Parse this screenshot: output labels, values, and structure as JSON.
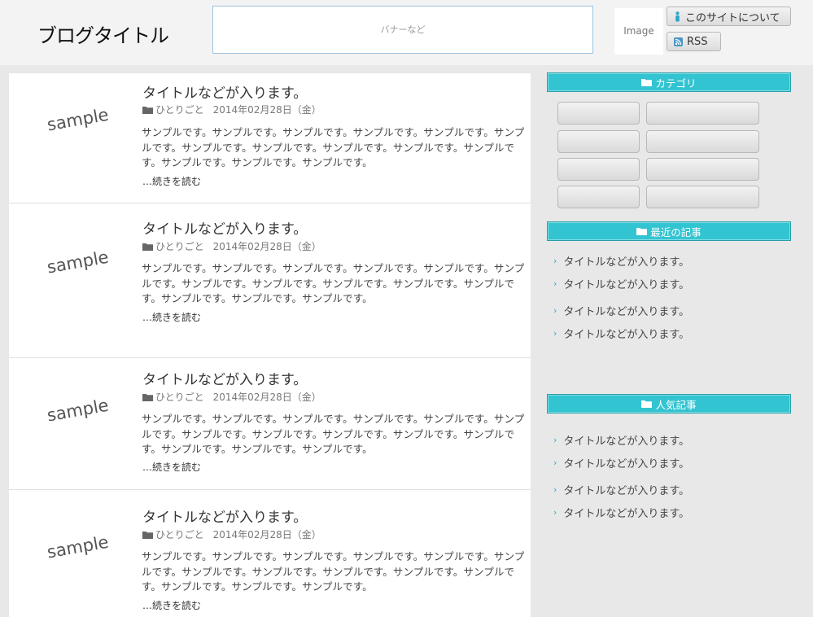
{
  "header": {
    "site_title": "ブログタイトル",
    "banner_text": "バナーなど",
    "image_text": "Image",
    "about_label": "このサイトについて",
    "rss_label": "RSS"
  },
  "posts": [
    {
      "thumb": "sample",
      "title": "タイトルなどが入ります。",
      "category": "ひとりごと",
      "date": "2014年02月28日（金）",
      "excerpt": "サンプルです。サンプルです。サンプルです。サンプルです。サンプルです。サンプルです。サンプルです。サンプルです。サンプルです。サンプルです。サンプルです。サンプルです。サンプルです。サンプルです。",
      "more": "…続きを読む"
    },
    {
      "thumb": "sample",
      "title": "タイトルなどが入ります。",
      "category": "ひとりごと",
      "date": "2014年02月28日（金）",
      "excerpt": "サンプルです。サンプルです。サンプルです。サンプルです。サンプルです。サンプルです。サンプルです。サンプルです。サンプルです。サンプルです。サンプルです。サンプルです。サンプルです。サンプルです。",
      "more": "…続きを読む"
    },
    {
      "thumb": "sample",
      "title": "タイトルなどが入ります。",
      "category": "ひとりごと",
      "date": "2014年02月28日（金）",
      "excerpt": "サンプルです。サンプルです。サンプルです。サンプルです。サンプルです。サンプルです。サンプルです。サンプルです。サンプルです。サンプルです。サンプルです。サンプルです。サンプルです。サンプルです。",
      "more": "…続きを読む"
    },
    {
      "thumb": "sample",
      "title": "タイトルなどが入ります。",
      "category": "ひとりごと",
      "date": "2014年02月28日（金）",
      "excerpt": "サンプルです。サンプルです。サンプルです。サンプルです。サンプルです。サンプルです。サンプルです。サンプルです。サンプルです。サンプルです。サンプルです。サンプルです。サンプルです。サンプルです。",
      "more": "…続きを読む"
    }
  ],
  "sidebar": {
    "category_heading": "カテゴリ",
    "recent_heading": "最近の記事",
    "recent_items": [
      "タイトルなどが入ります。",
      "タイトルなどが入ります。",
      "タイトルなどが入ります。",
      "タイトルなどが入ります。"
    ],
    "popular_heading": "人気記事",
    "popular_items": [
      "タイトルなどが入ります。",
      "タイトルなどが入ります。",
      "タイトルなどが入ります。",
      "タイトルなどが入ります。"
    ]
  },
  "colors": {
    "accent": "#33c4d1",
    "page_bg": "#e8e8e8",
    "header_bg": "#f3f3f3"
  },
  "icons": [
    "person-icon",
    "rss-icon",
    "folder-icon",
    "chevron-right-icon"
  ]
}
